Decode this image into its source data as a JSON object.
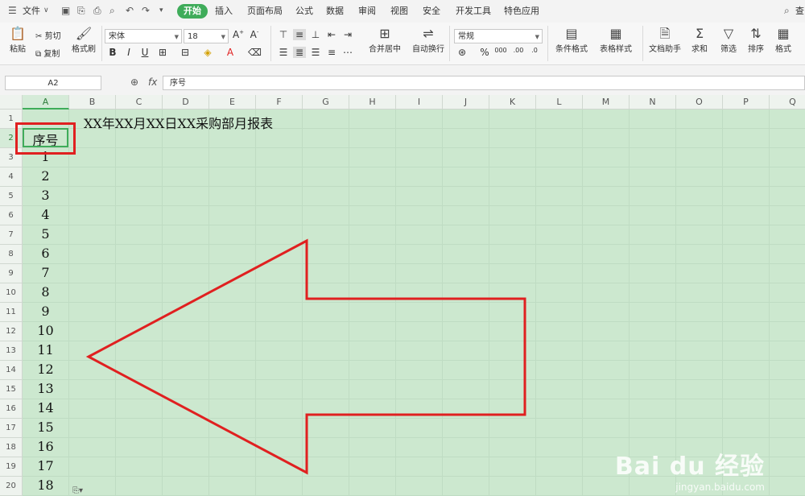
{
  "menubar": {
    "file": "文件",
    "tabs": [
      "开始",
      "插入",
      "页面布局",
      "公式",
      "数据",
      "审阅",
      "视图",
      "安全",
      "开发工具",
      "特色应用"
    ],
    "search_hint": "查"
  },
  "ribbon": {
    "paste": "粘贴",
    "cut": "剪切",
    "copy": "复制",
    "format_painter": "格式刷",
    "font_name": "宋体",
    "font_size": "18",
    "merge_center": "合并居中",
    "wrap_text": "自动换行",
    "number_format": "常规",
    "cond_format": "条件格式",
    "table_style": "表格样式",
    "doc_helper": "文档助手",
    "sum": "求和",
    "filter": "筛选",
    "sort": "排序",
    "format": "格式"
  },
  "formula_bar": {
    "name_box": "A2",
    "fx": "fx",
    "content": "序号"
  },
  "columns": [
    "A",
    "B",
    "C",
    "D",
    "E",
    "F",
    "G",
    "H",
    "I",
    "J",
    "K",
    "L",
    "M",
    "N",
    "O",
    "P",
    "Q"
  ],
  "rows": [
    "1",
    "2",
    "3",
    "4",
    "5",
    "6",
    "7",
    "8",
    "9",
    "10",
    "11",
    "12",
    "13",
    "14",
    "15",
    "16",
    "17",
    "18",
    "19",
    "20"
  ],
  "sheet": {
    "title": "XX年XX月XX日XX采购部月报表",
    "header": "序号",
    "numbers": [
      "1",
      "2",
      "3",
      "4",
      "5",
      "6",
      "7",
      "8",
      "9",
      "10",
      "11",
      "12",
      "13",
      "14",
      "15",
      "16",
      "17",
      "18"
    ]
  },
  "annotation": {
    "color": "#e02020"
  },
  "watermark": {
    "brand": "Bai du 经验",
    "url": "jingyan.baidu.com"
  }
}
